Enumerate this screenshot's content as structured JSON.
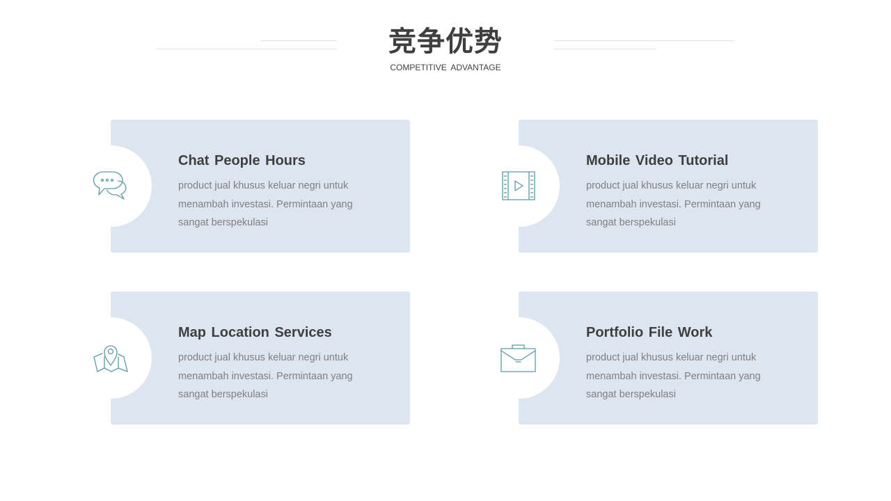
{
  "header": {
    "title": "竞争优势",
    "subtitle": "COMPETITIVE  ADVANTAGE"
  },
  "colors": {
    "card_background": "#dde5f1",
    "icon_stroke": "#5b9aa6",
    "title_text": "#3f3f3f",
    "body_text": "#808080"
  },
  "cards": [
    {
      "icon": "chat-bubbles-icon",
      "title": "Chat People Hours",
      "text": "product jual khusus keluar negri untuk\nmenambah investasi. Permintaan yang\nsangat  berspekulasi"
    },
    {
      "icon": "video-film-icon",
      "title": "Mobile Video Tutorial",
      "text": "product jual khusus keluar negri untuk\nmenambah investasi. Permintaan yang\nsangat  berspekulasi"
    },
    {
      "icon": "map-location-icon",
      "title": "Map Location Services",
      "text": "product jual khusus keluar negri untuk\nmenambah investasi. Permintaan yang\nsangat  berspekulasi"
    },
    {
      "icon": "briefcase-icon",
      "title": "Portfolio File Work",
      "text": "product jual khusus keluar negri untuk\nmenambah investasi. Permintaan yang\nsangat  berspekulasi"
    }
  ]
}
